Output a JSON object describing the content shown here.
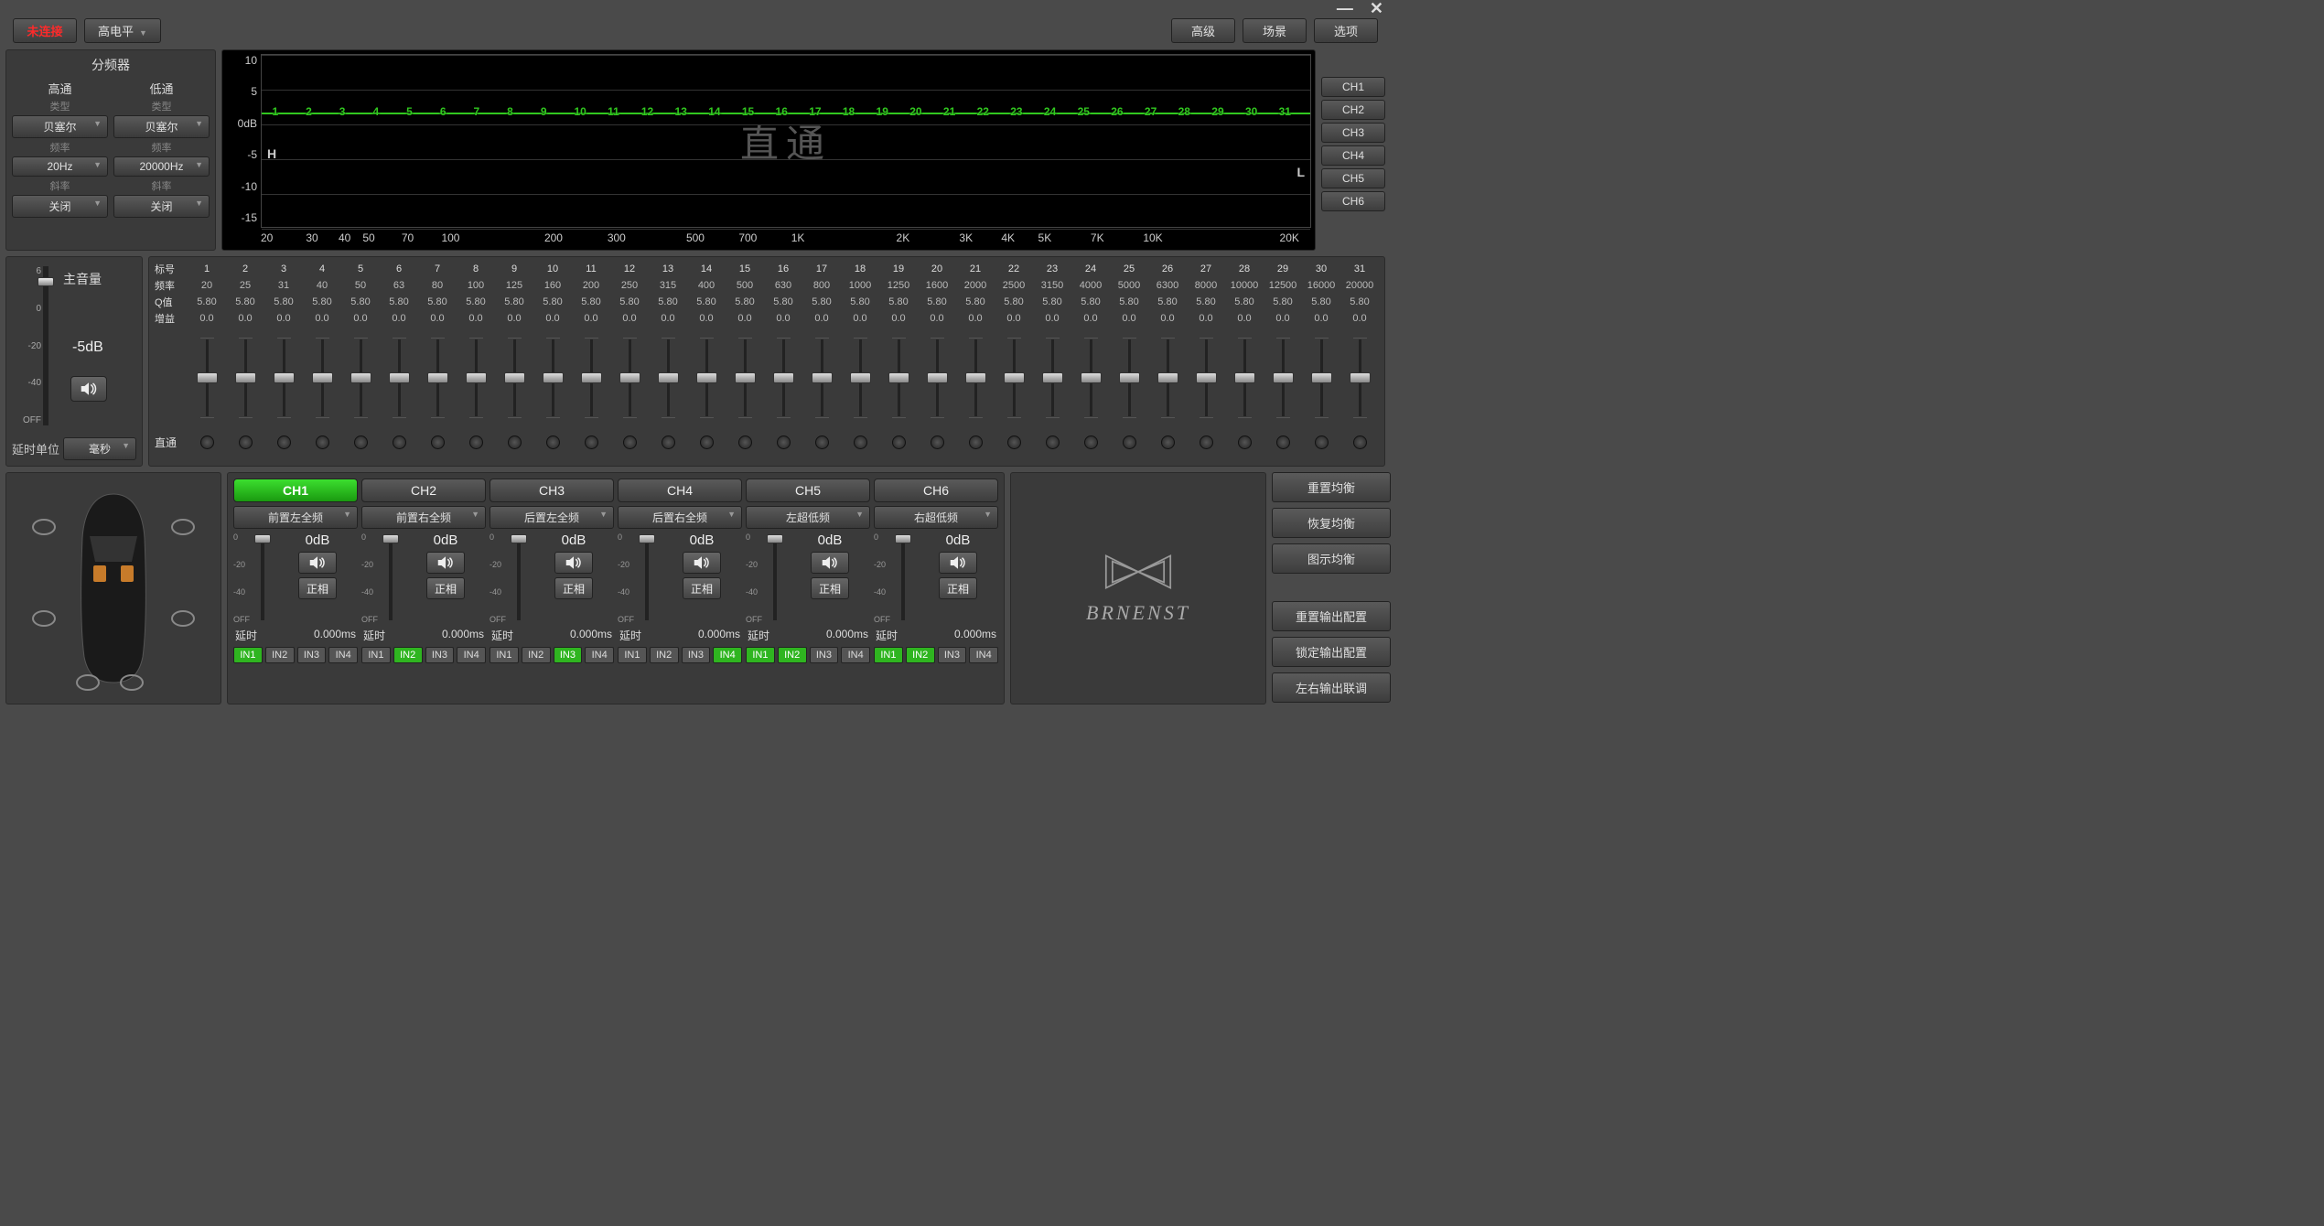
{
  "window": {
    "minimize": "—",
    "close": "✕"
  },
  "header": {
    "connect": "未连接",
    "level": "高电平",
    "advanced": "高级",
    "scene": "场景",
    "options": "选项"
  },
  "crossover": {
    "title": "分频器",
    "hp": "高通",
    "lp": "低通",
    "type": "类型",
    "freq": "频率",
    "slope": "斜率",
    "hp_type": "贝塞尔",
    "lp_type": "贝塞尔",
    "hp_freq": "20Hz",
    "lp_freq": "20000Hz",
    "hp_slope": "关闭",
    "lp_slope": "关闭"
  },
  "graph": {
    "yticks": [
      "10",
      "5",
      "0dB",
      "-5",
      "-10",
      "-15"
    ],
    "watermark": "直通",
    "H": "H",
    "L": "L",
    "xticks": [
      {
        "l": "20",
        "p": 0
      },
      {
        "l": "30",
        "p": 4.3
      },
      {
        "l": "40",
        "p": 7.4
      },
      {
        "l": "50",
        "p": 9.7
      },
      {
        "l": "70",
        "p": 13.4
      },
      {
        "l": "100",
        "p": 17.2
      },
      {
        "l": "200",
        "p": 27
      },
      {
        "l": "300",
        "p": 33
      },
      {
        "l": "500",
        "p": 40.5
      },
      {
        "l": "700",
        "p": 45.5
      },
      {
        "l": "1K",
        "p": 50.5
      },
      {
        "l": "2K",
        "p": 60.5
      },
      {
        "l": "3K",
        "p": 66.5
      },
      {
        "l": "4K",
        "p": 70.5
      },
      {
        "l": "5K",
        "p": 74
      },
      {
        "l": "7K",
        "p": 79
      },
      {
        "l": "10K",
        "p": 84
      },
      {
        "l": "20K",
        "p": 97
      }
    ]
  },
  "chtabs": [
    "CH1",
    "CH2",
    "CH3",
    "CH4",
    "CH5",
    "CH6"
  ],
  "volume": {
    "label": "主音量",
    "scale": [
      "6",
      "0",
      "-20",
      "-40",
      "OFF"
    ],
    "db": "-5dB",
    "delay_unit_label": "延时单位",
    "delay_unit": "毫秒"
  },
  "eq": {
    "rowlabels": {
      "band": "标号",
      "freq": "频率",
      "q": "Q值",
      "gain": "增益",
      "thru": "直通"
    },
    "bands": [
      1,
      2,
      3,
      4,
      5,
      6,
      7,
      8,
      9,
      10,
      11,
      12,
      13,
      14,
      15,
      16,
      17,
      18,
      19,
      20,
      21,
      22,
      23,
      24,
      25,
      26,
      27,
      28,
      29,
      30,
      31
    ],
    "freqs": [
      20,
      25,
      31,
      40,
      50,
      63,
      80,
      100,
      125,
      160,
      200,
      250,
      315,
      400,
      500,
      630,
      800,
      1000,
      1250,
      1600,
      2000,
      2500,
      3150,
      4000,
      5000,
      6300,
      8000,
      10000,
      12500,
      16000,
      20000
    ],
    "q": 5.8,
    "gain": "0.0"
  },
  "channels": [
    {
      "name": "CH1",
      "type": "前置左全频",
      "db": "0dB",
      "phase": "正相",
      "delay": "0.000ms",
      "ins": [
        true,
        false,
        false,
        false
      ],
      "active": true
    },
    {
      "name": "CH2",
      "type": "前置右全频",
      "db": "0dB",
      "phase": "正相",
      "delay": "0.000ms",
      "ins": [
        false,
        true,
        false,
        false
      ],
      "active": false
    },
    {
      "name": "CH3",
      "type": "后置左全频",
      "db": "0dB",
      "phase": "正相",
      "delay": "0.000ms",
      "ins": [
        false,
        false,
        true,
        false
      ],
      "active": false
    },
    {
      "name": "CH4",
      "type": "后置右全频",
      "db": "0dB",
      "phase": "正相",
      "delay": "0.000ms",
      "ins": [
        false,
        false,
        false,
        true
      ],
      "active": false
    },
    {
      "name": "CH5",
      "type": "左超低频",
      "db": "0dB",
      "phase": "正相",
      "delay": "0.000ms",
      "ins": [
        true,
        true,
        false,
        false
      ],
      "active": false
    },
    {
      "name": "CH6",
      "type": "右超低频",
      "db": "0dB",
      "phase": "正相",
      "delay": "0.000ms",
      "ins": [
        true,
        true,
        false,
        false
      ],
      "active": false
    }
  ],
  "ch_labels": {
    "delay": "延时",
    "fader_ticks": [
      "0",
      "-20",
      "-40",
      "OFF"
    ],
    "ins": [
      "IN1",
      "IN2",
      "IN3",
      "IN4"
    ]
  },
  "logo": "BRNENST",
  "rightbtns": {
    "reset_eq": "重置均衡",
    "restore_eq": "恢复均衡",
    "graphic_eq": "图示均衡",
    "reset_out": "重置输出配置",
    "lock_out": "锁定输出配置",
    "lr_link": "左右输出联调"
  }
}
